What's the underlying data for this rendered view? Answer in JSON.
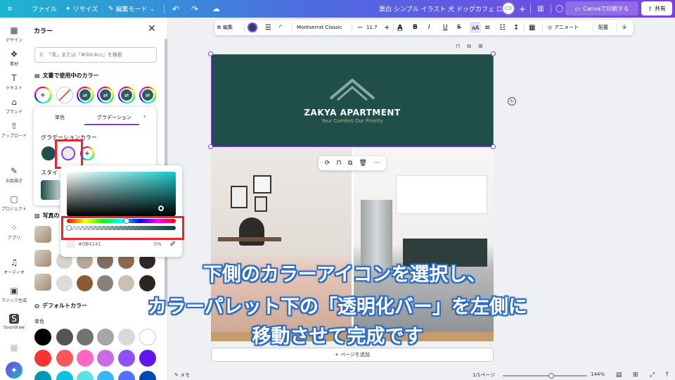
{
  "topbar": {
    "file": "ファイル",
    "resize": "リサイズ",
    "edit_mode": "編集モード",
    "doc_title": "黒白 シンプル イラスト 犬 ドッグカフェ ロゴ",
    "print": "Canvaで印刷する",
    "share": "共有"
  },
  "rail": [
    {
      "icon": "design-icon",
      "label": "デザイン"
    },
    {
      "icon": "elements-icon",
      "label": "素材"
    },
    {
      "icon": "text-icon",
      "label": "テキスト"
    },
    {
      "icon": "brand-icon",
      "label": "ブランド"
    },
    {
      "icon": "upload-icon",
      "label": "アップロード"
    },
    {
      "icon": "draw-icon",
      "label": "お絵描き"
    },
    {
      "icon": "projects-icon",
      "label": "プロジェクト"
    },
    {
      "icon": "apps-icon",
      "label": "アプリ"
    },
    {
      "icon": "audio-icon",
      "label": "オーディオ"
    },
    {
      "icon": "magic-icon",
      "label": "マジック生成"
    },
    {
      "icon": "soundraw-icon",
      "label": "Soundraw"
    }
  ],
  "panel": {
    "title": "カラー",
    "search_placeholder": "「青」または「#00c4cc」を検索",
    "doc_colors": "文書で使用中のカラー",
    "photo_colors": "写真の",
    "default_colors": "デフォルトカラー",
    "solid": "単色",
    "style_trunc": "スタイル"
  },
  "gradient": {
    "tab_solid": "単色",
    "tab_gradient": "グラデーション",
    "gradient_colors": "グラデーションカラー",
    "style": "スタイ"
  },
  "picker": {
    "hex": "#0B4141",
    "opacity": "0%"
  },
  "toolbar": {
    "edit": "編集",
    "font": "Montserrat Classic",
    "size": "11.7",
    "animate": "アニメート",
    "arrange": "配置"
  },
  "design": {
    "brand_name": "ZAKYA APARTMENT",
    "tagline": "Your Comfort Our Priority",
    "add_page": "+ ページを追加"
  },
  "bottom": {
    "notes": "メモ",
    "pages": "1/1ページ",
    "zoom": "144%"
  },
  "caption": {
    "line1": "下側のカラーアイコンを選択し、",
    "line2": "カラーパレット下の「透明化バー」を左側に",
    "line3": "移動させて完成です"
  },
  "colors": {
    "accent": "#8b3dff",
    "banner": "#1f4e4b",
    "highlight": "#e8262e"
  }
}
